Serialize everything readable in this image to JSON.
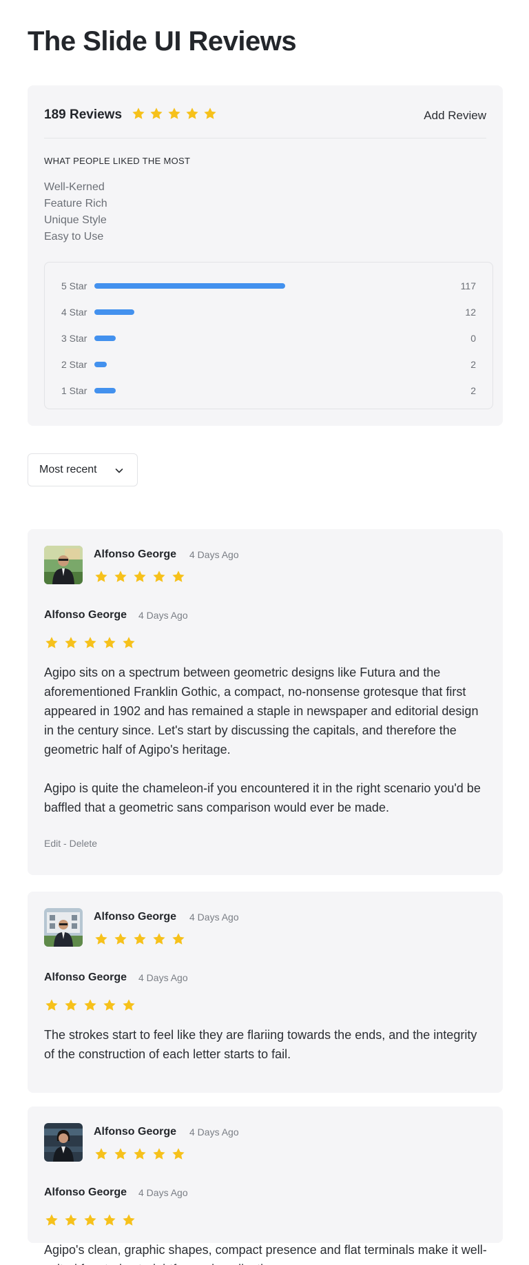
{
  "page": {
    "title": "The Slide UI Reviews"
  },
  "summary": {
    "review_count_label": "189 Reviews",
    "rating": 5,
    "add_review_label": "Add Review",
    "liked_heading": "WHAT PEOPLE LIKED THE MOST",
    "liked_items": [
      "Well-Kerned",
      "Feature Rich",
      "Unique Style",
      "Easy to Use"
    ],
    "distribution": [
      {
        "label": "5 Star",
        "count": "117",
        "bar_fraction": 0.62
      },
      {
        "label": "4 Star",
        "count": "12",
        "bar_fraction": 0.13
      },
      {
        "label": "3 Star",
        "count": "0",
        "bar_fraction": 0.07
      },
      {
        "label": "2 Star",
        "count": "2",
        "bar_fraction": 0.04
      },
      {
        "label": "1 Star",
        "count": "2",
        "bar_fraction": 0.07
      }
    ]
  },
  "sort": {
    "selected": "Most recent",
    "icon": "chevron-down-icon"
  },
  "reviews": [
    {
      "author": "Alfonso George",
      "date": "4 Days Ago",
      "rating": 5,
      "body": [
        "Agipo sits on a spectrum between geometric designs like Futura and the aforementioned Franklin Gothic, a compact, no-nonsense grotesque that first appeared in 1902 and has remained a staple in newspaper and editorial design in the century since. Let's start by discussing the capitals, and therefore the geometric half of Agipo's heritage.",
        "Agipo is quite the chameleon-if you encountered it in the right scenario you'd be baffled that a geometric sans comparison would ever be made."
      ],
      "actions": {
        "edit": "Edit",
        "separator": " - ",
        "delete": "Delete"
      }
    },
    {
      "author": "Alfonso George",
      "date": "4 Days Ago",
      "rating": 5,
      "body": [
        "The strokes start to feel like they are flariing towards the ends, and the integrity of the construction of each letter starts to fail."
      ]
    },
    {
      "author": "Alfonso George",
      "date": "4 Days Ago",
      "rating": 5,
      "body": [
        "Agipo's clean, graphic shapes, compact presence and flat terminals make it well-suited for stark, straightforward applications."
      ]
    }
  ],
  "colors": {
    "star": "#f6c11b",
    "bar": "#4391ee",
    "card_background": "#f5f5f7"
  }
}
